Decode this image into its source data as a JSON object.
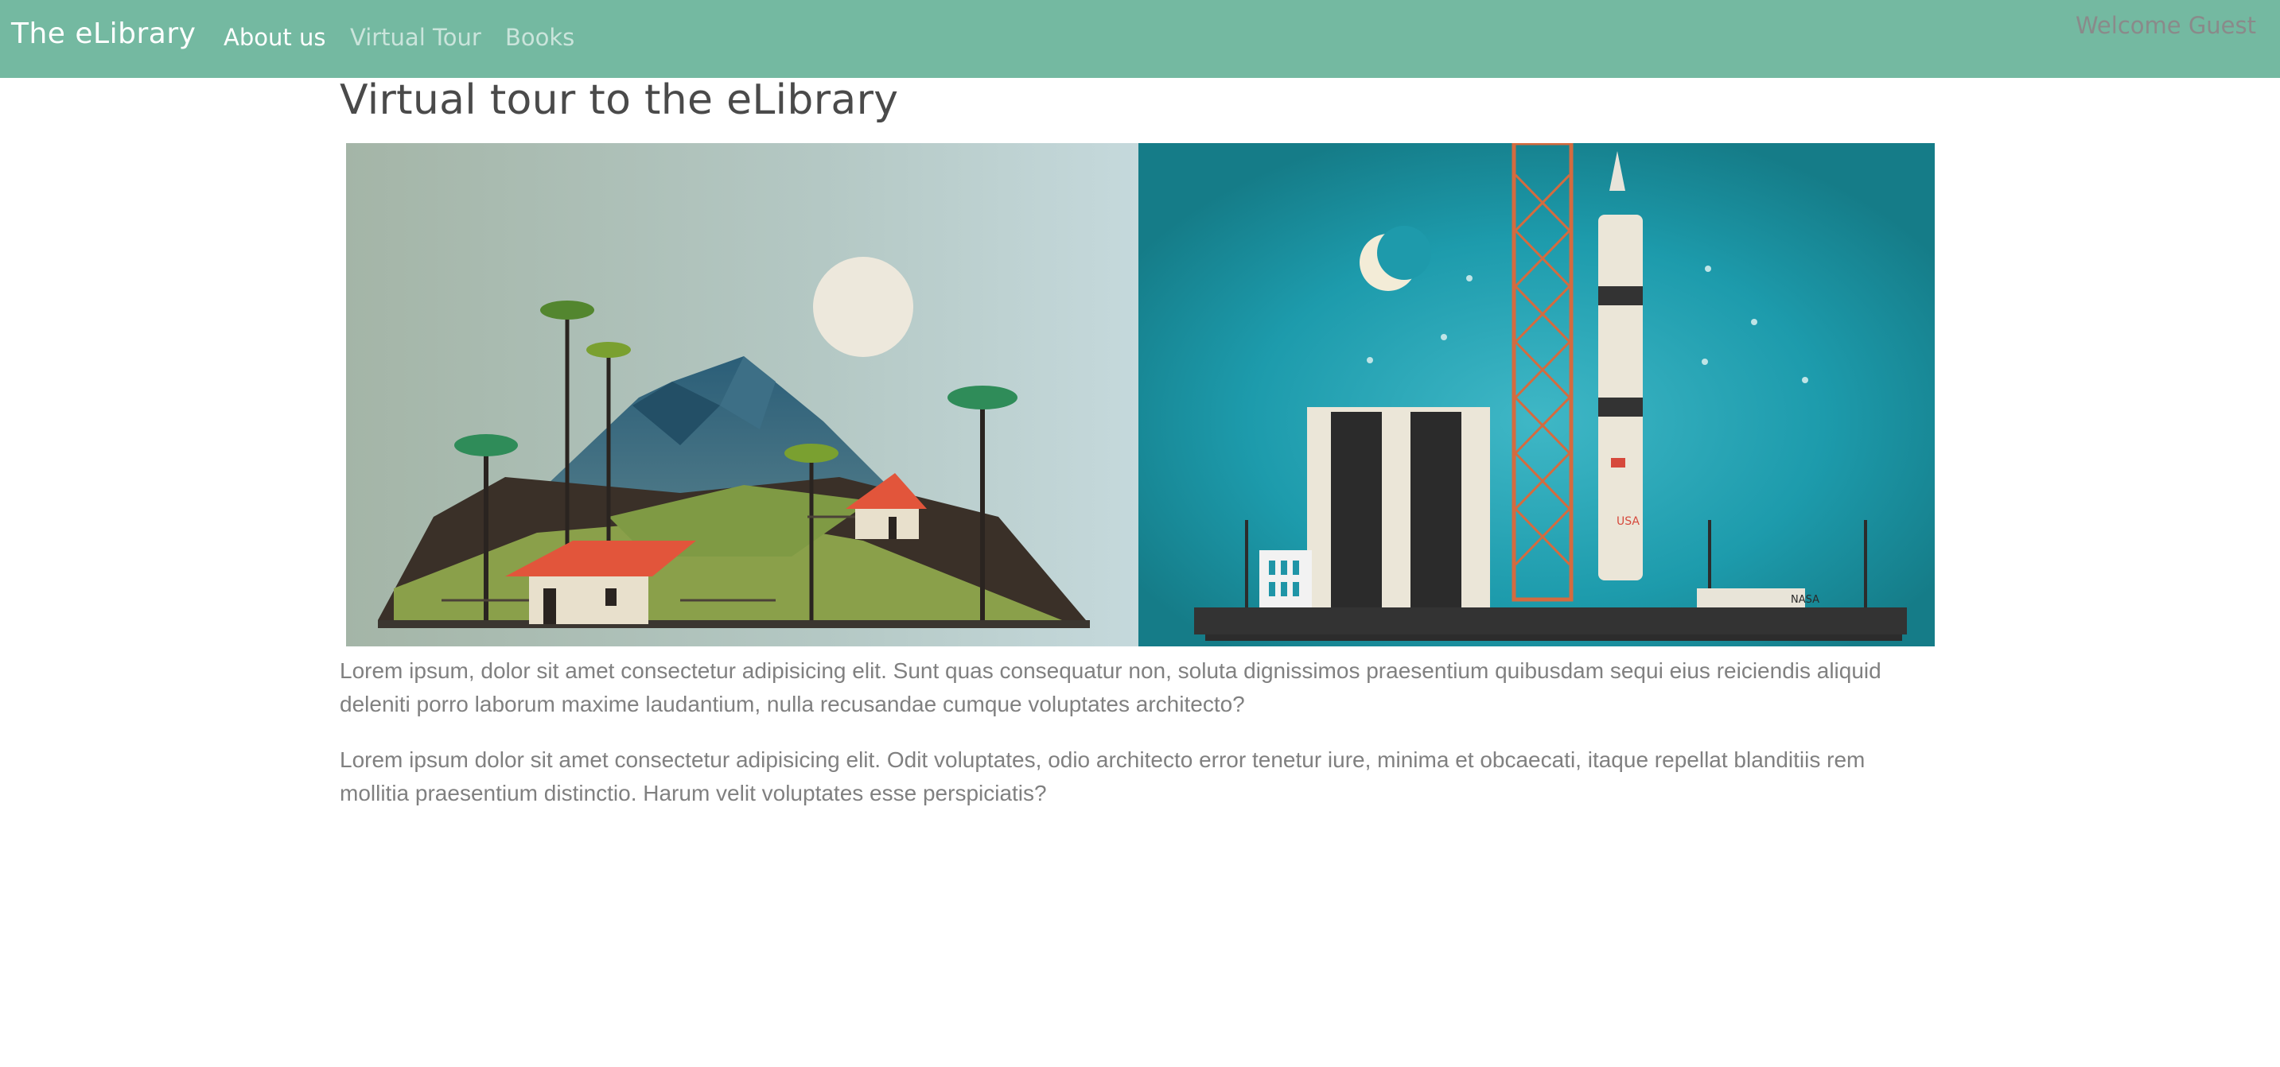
{
  "navbar": {
    "brand": "The eLibrary",
    "links": [
      {
        "label": "About us",
        "active": true
      },
      {
        "label": "Virtual Tour",
        "active": false
      },
      {
        "label": "Books",
        "active": false
      }
    ],
    "welcome": "Welcome Guest",
    "color": "#74b9a1"
  },
  "main": {
    "title": "Virtual tour to the eLibrary",
    "hero_image": {
      "left_scene": "village with mountains and palm trees",
      "right_scene": "rocket on launch pad with tower",
      "rocket_text": "USA",
      "building_text": "NASA"
    },
    "paragraphs": [
      "Lorem ipsum, dolor sit amet consectetur adipisicing elit. Sunt quas consequatur non, soluta dignissimos praesentium quibusdam sequi eius reiciendis aliquid deleniti porro laborum maxime laudantium, nulla recusandae cumque voluptates architecto?",
      "Lorem ipsum dolor sit amet consectetur adipisicing elit. Odit voluptates, odio architecto error tenetur iure, minima et obcaecati, itaque repellat blanditiis rem mollitia praesentium distinctio. Harum velit voluptates esse perspiciatis?"
    ]
  }
}
